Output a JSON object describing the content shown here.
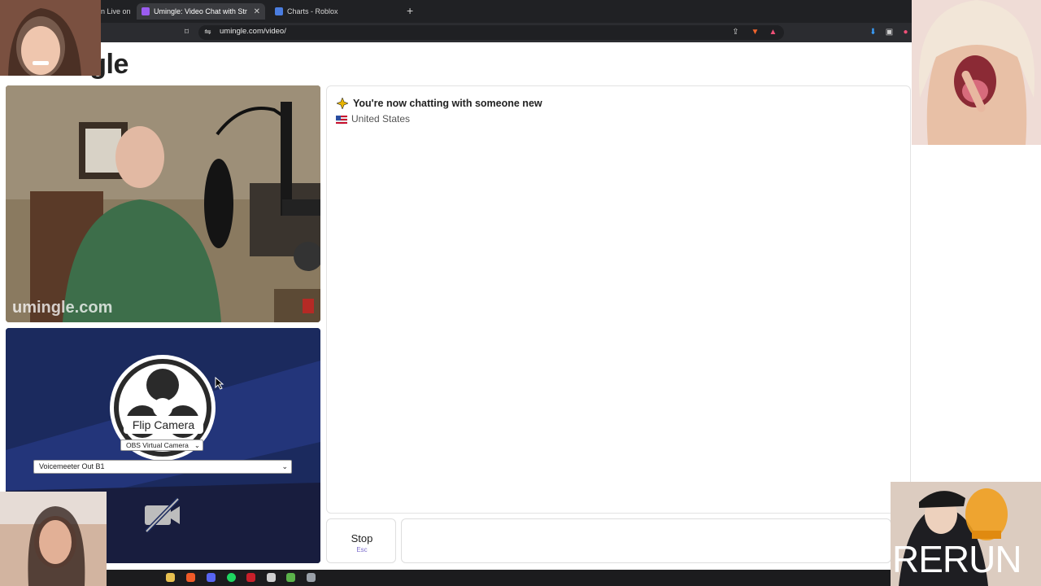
{
  "browser": {
    "tabs": [
      {
        "label": "n Live on",
        "active": false
      },
      {
        "label": "Umingle: Video Chat with Str",
        "active": true
      },
      {
        "label": "Charts - Roblox",
        "active": false
      }
    ],
    "url": "umingle.com/video/"
  },
  "site": {
    "logo_text": "ngle",
    "watermark": "umingle.com"
  },
  "self_video": {
    "flip_camera_label": "Flip Camera",
    "camera_select": "OBS Virtual Camera",
    "mic_select": "Voicemeeter Out B1"
  },
  "chat": {
    "status_text": "You're now chatting with someone new",
    "country": "United States"
  },
  "controls": {
    "stop_label": "Stop",
    "stop_shortcut": "Esc"
  },
  "stream_overlay": {
    "rerun_label": "RERUN"
  },
  "colors": {
    "accent": "#7b6ccc",
    "self_video_bg": "#1b2a5e",
    "tab_bar_bg": "#202124"
  }
}
